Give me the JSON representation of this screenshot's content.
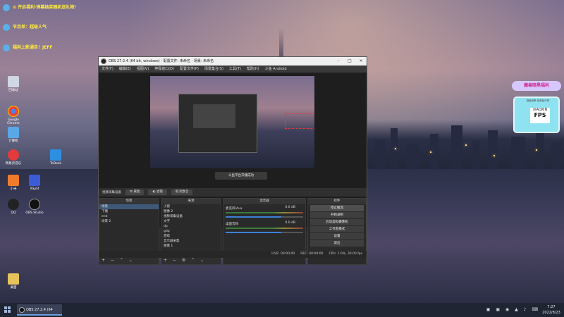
{
  "desktop": {
    "banners": [
      "⊙ 开启福利·弹幕抽奖随机送礼物！",
      "节目单：超级人气",
      "福利上新通告！JEFF"
    ],
    "icons": [
      {
        "label": "Google Chrome",
        "icon": "chrome-icon"
      },
      {
        "label": "回收站",
        "icon": "recycle-bin-icon"
      },
      {
        "label": "计算机",
        "icon": "computer-icon"
      },
      {
        "label": "网易云音乐",
        "icon": "music-icon"
      },
      {
        "label": "小米",
        "icon": "app-icon"
      },
      {
        "label": "QQ",
        "icon": "qq-icon"
      },
      {
        "label": "XSplit",
        "icon": "app-icon"
      },
      {
        "label": "ToDesk",
        "icon": "remote-icon"
      },
      {
        "label": "OBS Studio",
        "icon": "obs-icon"
      },
      {
        "label": "桌面",
        "icon": "folder-icon"
      }
    ]
  },
  "obs": {
    "title": "OBS 27.2.4 (64 bit, windows) - 配置文件: 未命名 - 场景: 未命名",
    "menu": [
      "文件(F)",
      "编辑(E)",
      "视图(V)",
      "停靠窗口(D)",
      "配置文件(P)",
      "场景集合(S)",
      "工具(T)",
      "帮助(H)",
      "斗鱼 Android"
    ],
    "toast": "斗鱼平台开播成功",
    "source_bar": {
      "label": "视频采集设备",
      "properties": "属性",
      "filters": "滤镜",
      "deactivate": "取消激活"
    },
    "scenes": {
      "header": "场景",
      "items": [
        "场景",
        "下播",
        "end",
        "场景 2"
      ]
    },
    "sources": {
      "header": "来源",
      "items": [
        "小窗",
        "图像 2",
        "视频采集设备",
        "文字",
        "dp",
        "gdp",
        "游戏",
        "显示器采集",
        "图像 1"
      ]
    },
    "mixer": {
      "header": "混音器",
      "channels": [
        {
          "name": "麦克风/Aux",
          "db": "0.0 dB",
          "level": 0.72
        },
        {
          "name": "桌面音频",
          "db": "0.0 dB",
          "level": 0.72
        }
      ]
    },
    "controls": {
      "header": "控件",
      "buttons": [
        "停止推流",
        "开始录制",
        "启动虚拟摄像机",
        "工作室模式",
        "设置",
        "退出"
      ]
    },
    "transitions": {
      "header": "转场特效",
      "type": "淡出",
      "duration_label": "时长",
      "duration": "300 ms"
    },
    "status": {
      "live": "LIVE: 00:00:00",
      "rec": "REC: 00:00:00",
      "cpu": "CPU: 1.0%, 30.00 fps"
    }
  },
  "widget": {
    "title": "魔兽暗黑福利",
    "subtitle": "魔兽暗黑 暗黑破坏神",
    "badge_top": "XIAOXIN",
    "badge_main": "FPS"
  },
  "taskbar": {
    "app": "OBS 27.2.4 (64 bit)...",
    "time": "7:27",
    "date": "2022/8/23"
  }
}
